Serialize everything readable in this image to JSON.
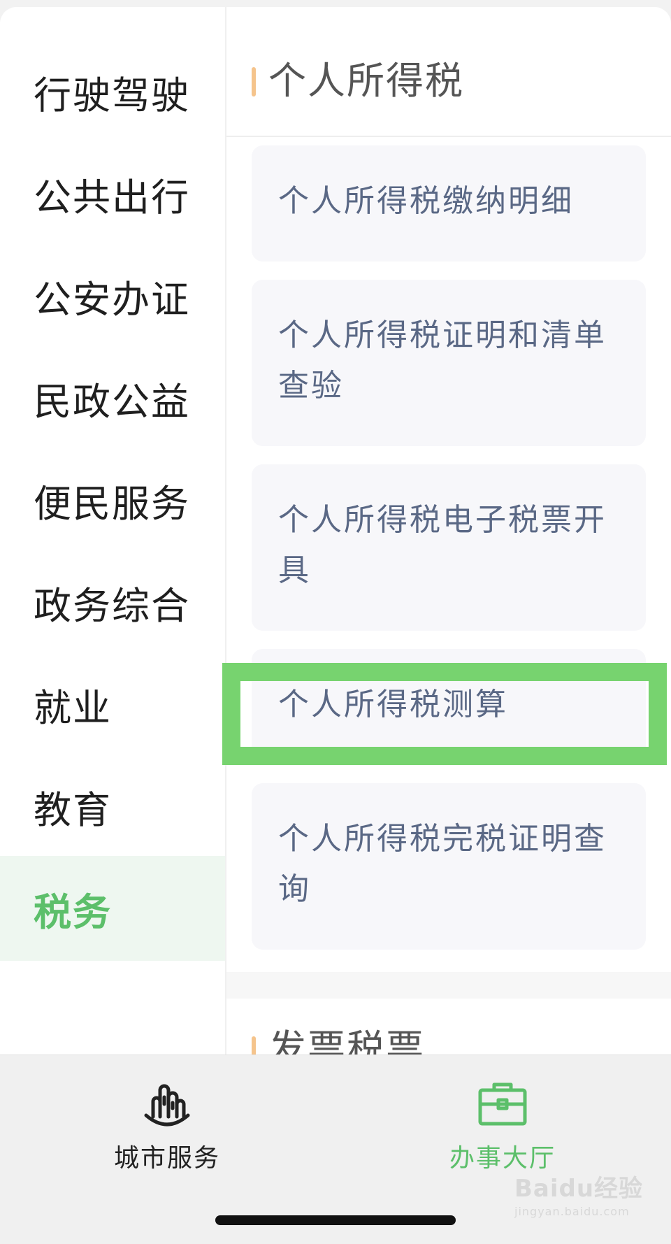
{
  "sidebar": {
    "items": [
      {
        "label": "行驶驾驶"
      },
      {
        "label": "公共出行"
      },
      {
        "label": "公安办证"
      },
      {
        "label": "民政公益"
      },
      {
        "label": "便民服务"
      },
      {
        "label": "政务综合"
      },
      {
        "label": "就业"
      },
      {
        "label": "教育"
      },
      {
        "label": "税务",
        "active": true
      }
    ]
  },
  "main": {
    "section_title": "个人所得税",
    "services": [
      {
        "label": "个人所得税缴纳明细"
      },
      {
        "label": "个人所得税证明和清单查验"
      },
      {
        "label": "个人所得税电子税票开具"
      },
      {
        "label": "个人所得税测算",
        "highlighted": true
      },
      {
        "label": "个人所得税完税证明查询"
      }
    ],
    "next_section_title": "发票税票"
  },
  "tabbar": {
    "tabs": [
      {
        "label": "城市服务",
        "icon": "city-buildings-icon",
        "active": false
      },
      {
        "label": "办事大厅",
        "icon": "briefcase-icon",
        "active": true
      }
    ]
  },
  "watermark": {
    "brand": "Baidu经验",
    "url": "jingyan.baidu.com"
  },
  "colors": {
    "accent_green": "#5cbf6a",
    "highlight_green": "#77d36f",
    "section_bar": "#f5c48c",
    "service_text": "#5a6885"
  }
}
